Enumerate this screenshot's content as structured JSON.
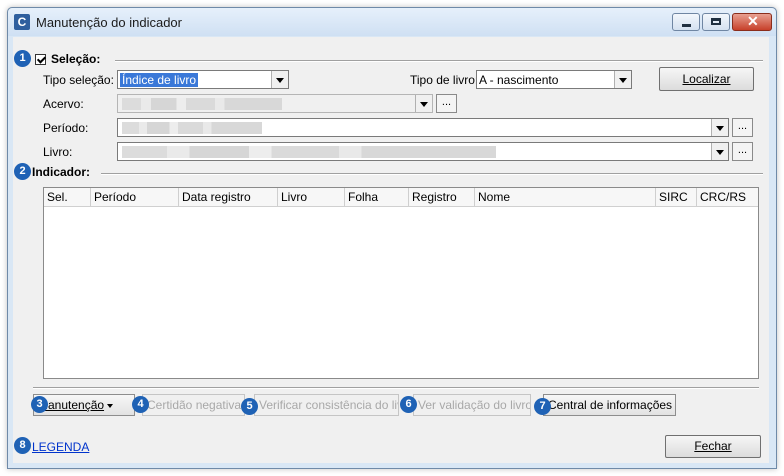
{
  "window": {
    "title": "Manutenção do indicador",
    "app_icon": "C"
  },
  "badges": [
    "1",
    "2",
    "3",
    "4",
    "5",
    "6",
    "7",
    "8"
  ],
  "selecao": {
    "title": "Seleção:",
    "tipo_selecao_label": "Tipo seleção:",
    "tipo_selecao_value": "Índice de livro",
    "tipo_livro_label": "Tipo de livro:",
    "tipo_livro_value": "A - nascimento",
    "localizar_label": "Localizar",
    "acervo_label": "Acervo:",
    "periodo_label": "Período:",
    "livro_label": "Livro:",
    "dots_label": "..."
  },
  "indicador": {
    "title": "Indicador:",
    "columns": [
      "Sel.",
      "Período",
      "Data registro",
      "Livro",
      "Folha",
      "Registro",
      "Nome",
      "SIRC",
      "CRC/RS"
    ]
  },
  "toolbar": {
    "manutencao": "Manutenção",
    "certidao": "Certidão negativa...",
    "verificar": "Verificar consistência do livro...",
    "ver_validacao": "Ver validação do livro...",
    "central": "Central de informações"
  },
  "footer": {
    "legenda": "LEGENDA",
    "fechar": "Fechar"
  }
}
